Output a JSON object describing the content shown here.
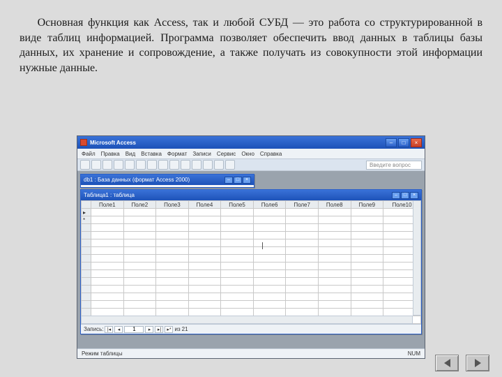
{
  "paragraph": "Основная функция как Access, так и любой СУБД — это работа со структурированной в виде таблиц информацией. Программа позволяет обеспечить ввод данных в таблицы базы данных, их хранение и сопровождение, а также получать из совокупности этой информации нужные данные.",
  "app": {
    "title": "Microsoft Access",
    "menus": [
      "Файл",
      "Правка",
      "Вид",
      "Вставка",
      "Формат",
      "Записи",
      "Сервис",
      "Окно",
      "Справка"
    ],
    "search_placeholder": "Введите вопрос"
  },
  "dbwindow": {
    "title": "db1 : База данных (формат Access 2000)"
  },
  "tablewindow": {
    "title": "Таблица1 : таблица",
    "columns": [
      "Поле1",
      "Поле2",
      "Поле3",
      "Поле4",
      "Поле5",
      "Поле6",
      "Поле7",
      "Поле8",
      "Поле9",
      "Поле10"
    ]
  },
  "recordnav": {
    "label": "Запись:",
    "value": "1",
    "of_label": "из",
    "total": "21"
  },
  "status": {
    "mode": "Режим таблицы",
    "indicator": "NUM"
  },
  "winbuttons": {
    "min": "–",
    "max": "□",
    "close": "×"
  }
}
